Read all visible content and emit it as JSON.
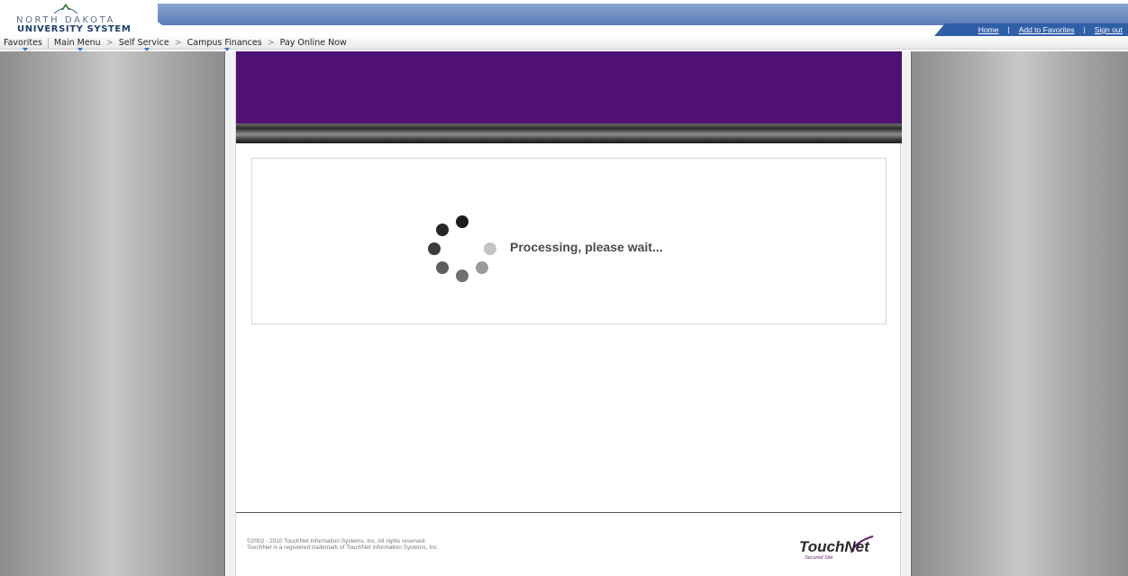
{
  "header": {
    "logo_line1": "NORTH DAKOTA",
    "logo_line2": "UNIVERSITY SYSTEM",
    "links": [
      "Home",
      "Add to Favorites",
      "Sign out"
    ],
    "separator": "|"
  },
  "breadcrumb": {
    "items": [
      "Favorites",
      "Main Menu",
      "Self Service",
      "Campus Finances",
      "Pay Online Now"
    ],
    "separator": ">"
  },
  "processing": {
    "message": "Processing, please wait..."
  },
  "footer": {
    "copyright_line1": "©2002 - 2010 TouchNet Information Systems, Inc. All rights reserved.",
    "copyright_line2": "TouchNet is a registered trademark of TouchNet Information Systems, Inc.",
    "logo_text": "TouchNet",
    "logo_subtext": "Secured Site"
  },
  "colors": {
    "banner_purple": "#4f1173",
    "header_blue": "#2f5fa7",
    "processing_text": "#4a4a4a"
  },
  "icons": [
    "ndus-emblem-icon",
    "spinner-icon",
    "touchnet-logo"
  ]
}
